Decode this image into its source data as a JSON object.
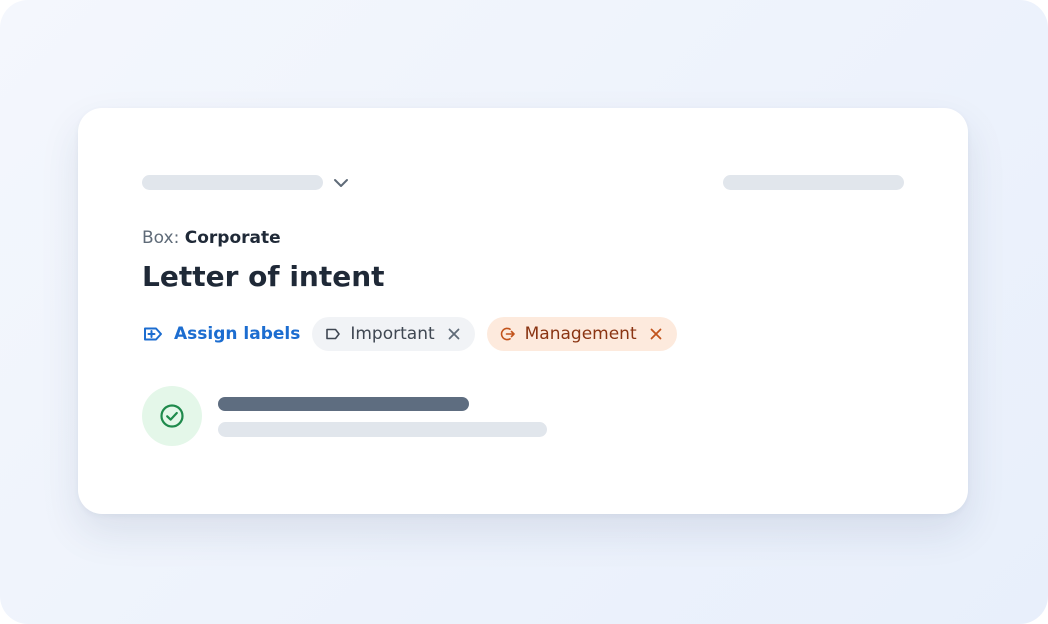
{
  "document": {
    "box_label": "Box:",
    "box_value": "Corporate",
    "title": "Letter of intent"
  },
  "labels": {
    "assign_label": "Assign labels",
    "chips": [
      {
        "name": "Important",
        "color": "#3f4752",
        "background": "#f1f3f6",
        "icon": "label-outline-icon"
      },
      {
        "name": "Management",
        "color": "#8a3412",
        "background": "#fdeadd",
        "icon": "label-arrow-icon"
      }
    ]
  },
  "colors": {
    "accent": "#1c6dd0",
    "success": "#1f8a4c",
    "success_bg": "#e4f7e9"
  }
}
